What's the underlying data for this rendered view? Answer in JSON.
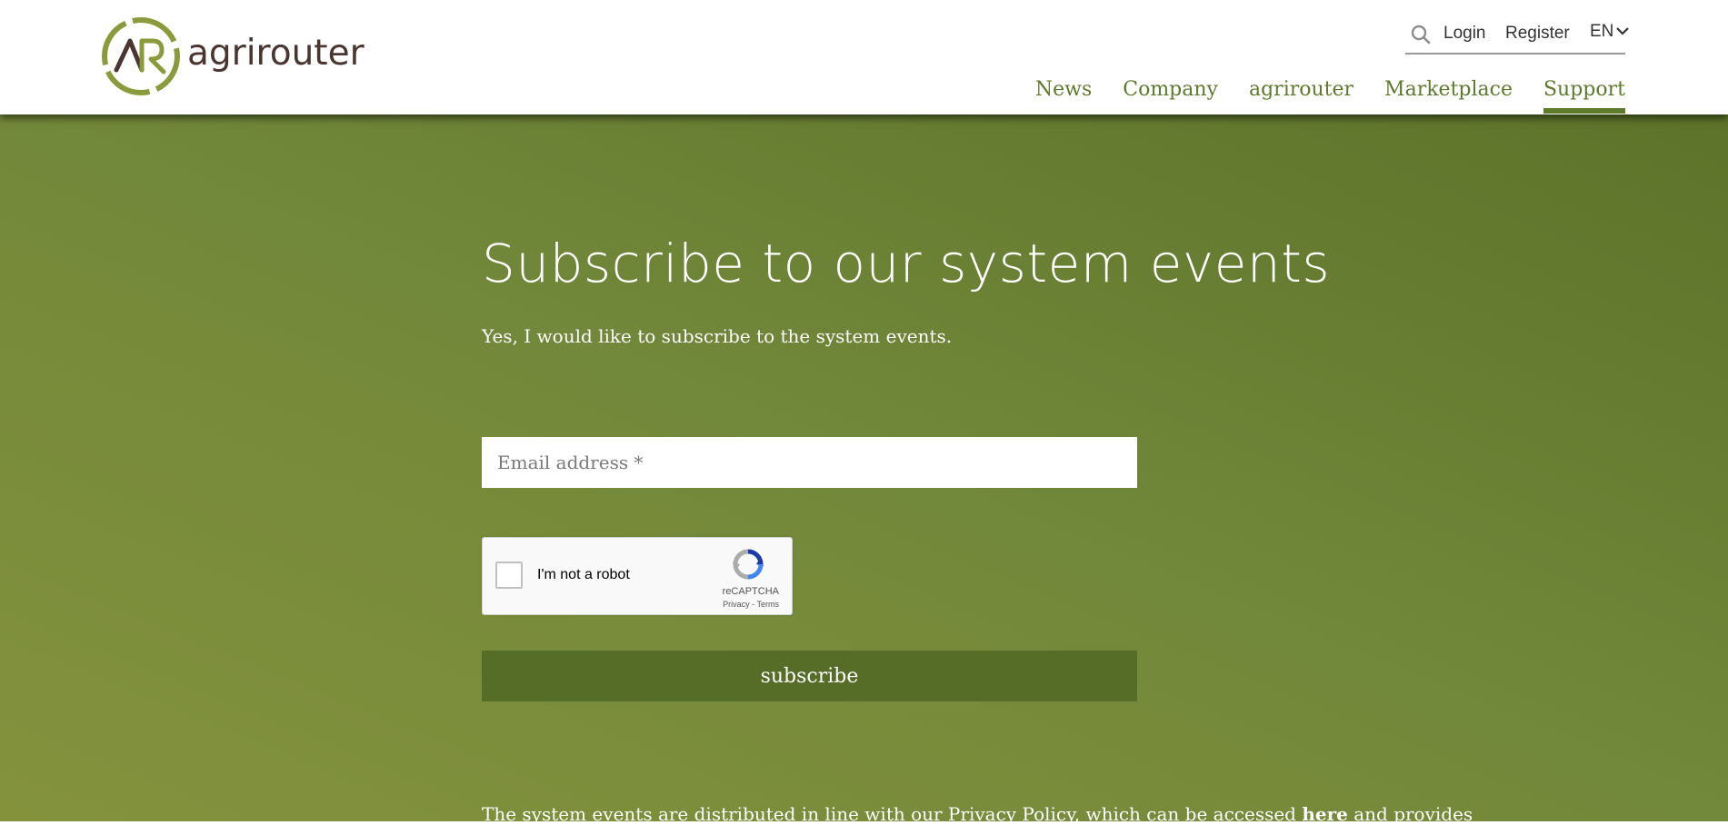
{
  "brand": {
    "logo_text": "agrirouter",
    "logo_colors": {
      "ring": "#8a9b3c",
      "text": "#4a3530"
    }
  },
  "header": {
    "utility": {
      "search_icon": "search-icon",
      "login_label": "Login",
      "register_label": "Register",
      "language_label": "EN",
      "language_icon": "chevron-down-icon"
    },
    "nav": {
      "items": [
        {
          "label": "News",
          "active": false
        },
        {
          "label": "Company",
          "active": false
        },
        {
          "label": "agrirouter",
          "active": false
        },
        {
          "label": "Marketplace",
          "active": false
        },
        {
          "label": "Support",
          "active": true
        }
      ],
      "color": "#5d7a2d"
    }
  },
  "main": {
    "title": "Subscribe to our system events",
    "subtitle": "Yes, I would like to subscribe to the system events.",
    "email": {
      "value": "",
      "placeholder": "Email address *"
    },
    "recaptcha": {
      "label": "I'm not a robot",
      "brand": "reCAPTCHA",
      "privacy": "Privacy",
      "separator": " - ",
      "terms": "Terms",
      "checked": false
    },
    "subscribe_label": "subscribe",
    "footnote": {
      "before": "The system events are distributed in line with our Privacy Policy, which can be accessed ",
      "link": "here",
      "after": " and provides"
    },
    "colors": {
      "background_gradient": [
        "#84923c",
        "#72883a",
        "#5c7329"
      ],
      "button": "#566d28"
    }
  }
}
